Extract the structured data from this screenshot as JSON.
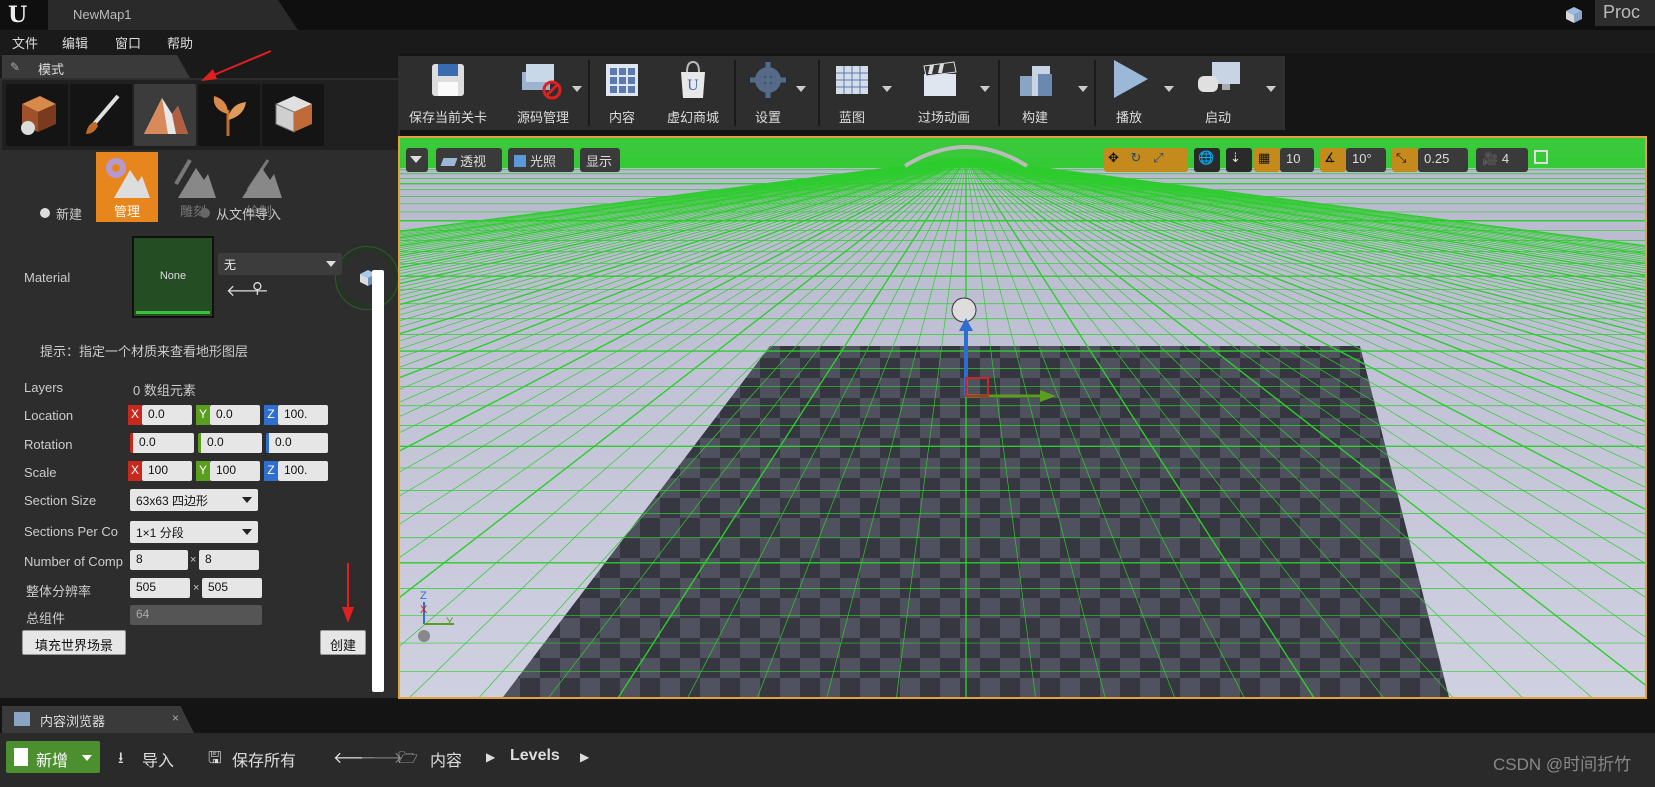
{
  "window": {
    "tab_title": "NewMap1",
    "right_text": "Proc"
  },
  "menu": [
    "文件",
    "编辑",
    "窗口",
    "帮助"
  ],
  "modes_panel": {
    "tab_label": "模式",
    "sub_modes": [
      {
        "label": "管理",
        "active": true
      },
      {
        "label": "雕刻",
        "active": false
      },
      {
        "label": "绘制",
        "active": false
      }
    ],
    "radio_options": [
      "新建",
      "从文件导入"
    ],
    "material": {
      "label": "Material",
      "thumb_text": "None",
      "dropdown_value": "无"
    },
    "hint": "提示：指定一个材质来查看地形图层",
    "layers": {
      "label": "Layers",
      "value": "0 数组元素"
    },
    "location": {
      "label": "Location",
      "x": "0.0",
      "y": "0.0",
      "z": "100."
    },
    "rotation": {
      "label": "Rotation",
      "x": "0.0",
      "y": "0.0",
      "z": "0.0"
    },
    "scale": {
      "label": "Scale",
      "x": "100",
      "y": "100",
      "z": "100."
    },
    "section_size": {
      "label": "Section Size",
      "value": "63x63 四边形"
    },
    "sections_per_component": {
      "label": "Sections Per Co",
      "value": "1×1 分段"
    },
    "number_of_components": {
      "label": "Number of Comp",
      "x": "8",
      "y": "8"
    },
    "overall_resolution": {
      "label": "整体分辨率",
      "x": "505",
      "y": "505"
    },
    "total_components": {
      "label": "总组件",
      "value": "64"
    },
    "fill_world_button": "填充世界场景",
    "create_button": "创建"
  },
  "main_toolbar": [
    {
      "label": "保存当前关卡",
      "icon": "save-icon"
    },
    {
      "label": "源码管理",
      "icon": "source-control-icon"
    },
    {
      "label": "内容",
      "icon": "content-icon"
    },
    {
      "label": "虚幻商城",
      "icon": "marketplace-icon"
    },
    {
      "label": "设置",
      "icon": "settings-icon"
    },
    {
      "label": "蓝图",
      "icon": "blueprint-icon"
    },
    {
      "label": "过场动画",
      "icon": "cinematics-icon"
    },
    {
      "label": "构建",
      "icon": "build-icon"
    },
    {
      "label": "播放",
      "icon": "play-icon"
    },
    {
      "label": "启动",
      "icon": "launch-icon"
    }
  ],
  "viewport": {
    "perspective": "透视",
    "lit": "光照",
    "show": "显示",
    "grid_snap": "10",
    "rotation_snap": "10°",
    "scale_snap": "0.25",
    "camera_speed": "4",
    "axis_z": "Z",
    "axis_x": "X",
    "axis_y": "Y"
  },
  "content_browser": {
    "tab_label": "内容浏览器",
    "new_button": "新增",
    "import_button": "导入",
    "save_all_button": "保存所有",
    "breadcrumb": [
      "内容",
      "Levels"
    ]
  },
  "watermark": "CSDN @时间折竹",
  "colors": {
    "accent": "#e8861e",
    "grid_green": "#2ecc2e",
    "axis_x": "#c8281e",
    "axis_y": "#5a9e1e",
    "axis_z": "#2e6ed0"
  }
}
